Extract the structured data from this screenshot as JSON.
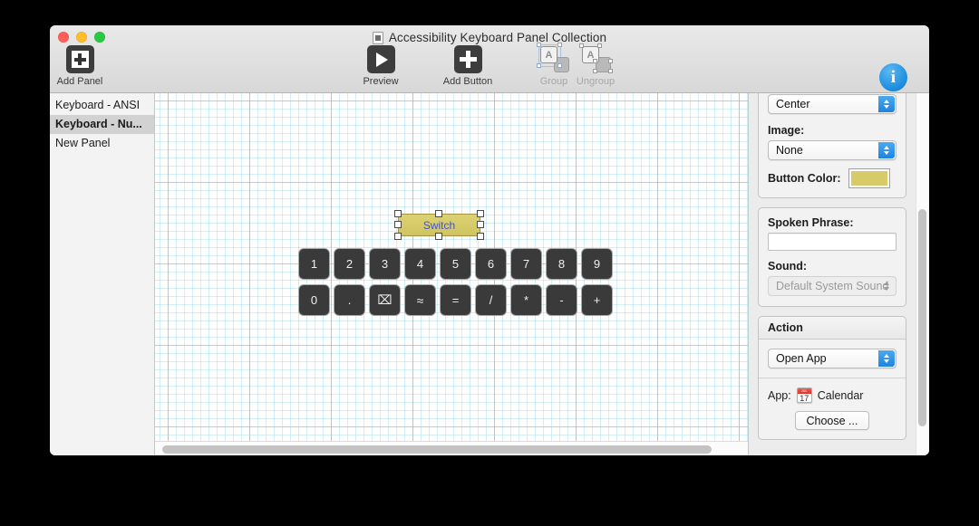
{
  "window": {
    "title": "Accessibility Keyboard Panel Collection",
    "doc_icon": "document-icon"
  },
  "traffic_lights": [
    {
      "name": "close-button",
      "color": "#ff5f57"
    },
    {
      "name": "minimize-button",
      "color": "#febc2e"
    },
    {
      "name": "zoom-button",
      "color": "#28c840"
    }
  ],
  "toolbar": {
    "add_panel": {
      "label": "Add Panel",
      "icon": "add-panel-icon",
      "enabled": true
    },
    "preview": {
      "label": "Preview",
      "icon": "play-icon",
      "enabled": true
    },
    "add_button": {
      "label": "Add Button",
      "icon": "plus-icon",
      "enabled": true
    },
    "group": {
      "label": "Group",
      "icon": "group-icon",
      "enabled": false
    },
    "ungroup": {
      "label": "Ungroup",
      "icon": "ungroup-icon",
      "enabled": false
    },
    "inspector": {
      "label": "Inspector",
      "icon": "info-icon",
      "glyph": "i",
      "enabled": true
    }
  },
  "sidebar": {
    "items": [
      {
        "label": "Keyboard - ANSI",
        "selected": false
      },
      {
        "label": "Keyboard - Nu...",
        "selected": true
      },
      {
        "label": "New Panel",
        "selected": false
      }
    ]
  },
  "canvas": {
    "selected_button": {
      "label": "Switch",
      "color": "#d6cb68",
      "text_color": "#4453c8"
    },
    "keypad_row1": [
      "1",
      "2",
      "3",
      "4",
      "5",
      "6",
      "7",
      "8",
      "9"
    ],
    "keypad_row2": [
      "0",
      ".",
      "⌧",
      "≈",
      "=",
      "/",
      "*",
      "-",
      "+"
    ]
  },
  "inspector": {
    "alignment_value": "Center",
    "image_label": "Image:",
    "image_value": "None",
    "button_color_label": "Button Color:",
    "button_color_value": "#d6cb68",
    "spoken_phrase_label": "Spoken Phrase:",
    "spoken_phrase_value": "",
    "spoken_phrase_placeholder": "",
    "sound_label": "Sound:",
    "sound_value": "Default System Sound",
    "action_header": "Action",
    "action_value": "Open App",
    "app_label": "App:",
    "app_name": "Calendar",
    "app_icon": "calendar-icon",
    "app_icon_month": "JUL",
    "app_icon_day": "17",
    "choose_label": "Choose ..."
  }
}
